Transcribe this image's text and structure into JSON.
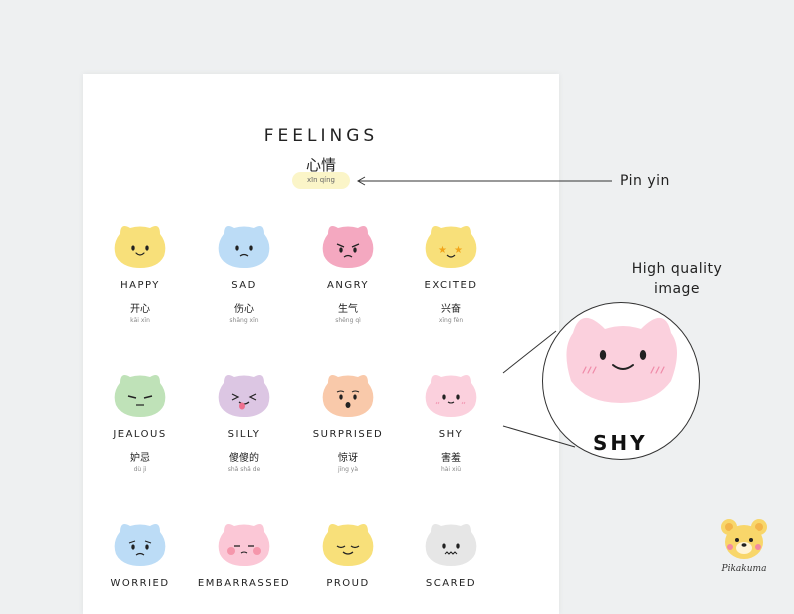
{
  "poster": {
    "title": "FEELINGS",
    "title_zh": "心情",
    "title_pinyin": "xīn qíng"
  },
  "feelings": [
    {
      "en": "HAPPY",
      "zh": "开心",
      "py": "kāi xīn",
      "color": "#f8e07a",
      "face": "smile"
    },
    {
      "en": "SAD",
      "zh": "伤心",
      "py": "shāng xīn",
      "color": "#bcdcf6",
      "face": "sad"
    },
    {
      "en": "ANGRY",
      "zh": "生气",
      "py": "shēng qì",
      "color": "#f4a8c0",
      "face": "angry"
    },
    {
      "en": "EXCITED",
      "zh": "兴奋",
      "py": "xīng fèn",
      "color": "#f8e07a",
      "face": "stars"
    },
    {
      "en": "JEALOUS",
      "zh": "妒忌",
      "py": "dù jì",
      "color": "#bfe2b8",
      "face": "jealous"
    },
    {
      "en": "SILLY",
      "zh": "傻傻的",
      "py": "shǎ shǎ de",
      "color": "#dcc6e3",
      "face": "silly"
    },
    {
      "en": "SURPRISED",
      "zh": "惊讶",
      "py": "jīng yà",
      "color": "#f9c9aa",
      "face": "surprised"
    },
    {
      "en": "SHY",
      "zh": "害羞",
      "py": "hài xiū",
      "color": "#fbd0dd",
      "face": "shy"
    },
    {
      "en": "WORRIED",
      "zh": "",
      "py": "",
      "color": "#bcdcf6",
      "face": "worried"
    },
    {
      "en": "EMBARRASSED",
      "zh": "",
      "py": "",
      "color": "#fbc7d6",
      "face": "embarrassed"
    },
    {
      "en": "PROUD",
      "zh": "",
      "py": "",
      "color": "#f8e07a",
      "face": "proud"
    },
    {
      "en": "SCARED",
      "zh": "",
      "py": "",
      "color": "#e6e6e6",
      "face": "scared"
    }
  ],
  "callouts": {
    "pinyin": "Pin yin",
    "quality_line1": "High quality",
    "quality_line2": "image",
    "zoom_label": "SHY"
  },
  "brand": {
    "name": "Pikakuma",
    "color": "#f8d66a"
  }
}
